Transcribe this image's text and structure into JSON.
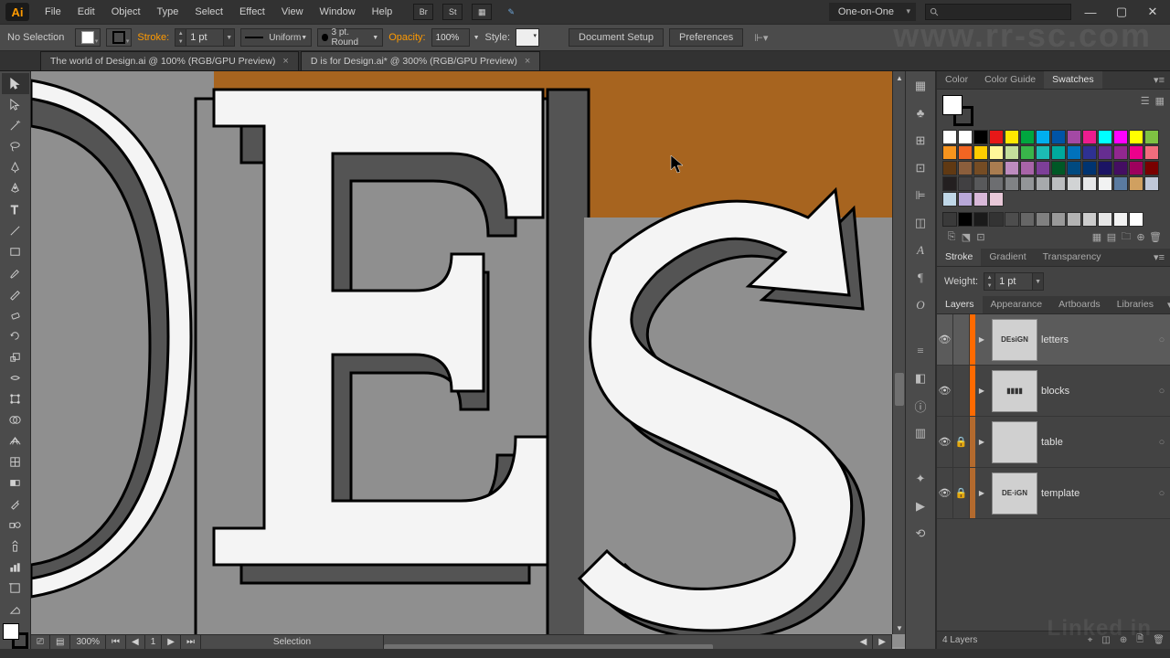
{
  "menu": {
    "items": [
      "File",
      "Edit",
      "Object",
      "Type",
      "Select",
      "Effect",
      "View",
      "Window",
      "Help"
    ]
  },
  "workspace": "One-on-One",
  "controlbar": {
    "selection": "No Selection",
    "stroke_label": "Stroke:",
    "stroke_weight": "1 pt",
    "stroke_profile": "Uniform",
    "brush": "3 pt. Round",
    "opacity_label": "Opacity:",
    "opacity": "100%",
    "style_label": "Style:",
    "btn_docsetup": "Document Setup",
    "btn_prefs": "Preferences"
  },
  "tabs": [
    {
      "title": "The world of Design.ai @ 100% (RGB/GPU Preview)",
      "active": false
    },
    {
      "title": "D is for Design.ai* @ 300% (RGB/GPU Preview)",
      "active": true
    }
  ],
  "statusbar": {
    "zoom": "300%",
    "artboard_nav": "1",
    "mode": "Selection"
  },
  "panels": {
    "color_tabs": [
      "Color",
      "Color Guide",
      "Swatches"
    ],
    "stroke_tabs": [
      "Stroke",
      "Gradient",
      "Transparency"
    ],
    "stroke_weight_label": "Weight:",
    "stroke_weight": "1 pt",
    "layer_tabs": [
      "Layers",
      "Appearance",
      "Artboards",
      "Libraries"
    ],
    "layers": [
      {
        "name": "letters",
        "color": "#ff6a00",
        "locked": false,
        "thumb_text": "DEsiGN"
      },
      {
        "name": "blocks",
        "color": "#ff6a00",
        "locked": false,
        "thumb_text": "▮▮▮▮"
      },
      {
        "name": "table",
        "color": "#b36a2e",
        "locked": true,
        "thumb_text": ""
      },
      {
        "name": "template",
        "color": "#b36a2e",
        "locked": true,
        "thumb_text": "DE·iGN"
      }
    ],
    "layer_count": "4 Layers"
  },
  "swatches": {
    "rows": [
      [
        "#ffffff",
        "#ffffff",
        "#000000",
        "#e71818",
        "#ffe800",
        "#00a63f",
        "#00aeef",
        "#0054a6",
        "#a349a4",
        "#ed1c8f",
        "#00ffff",
        "#ff00ff",
        "#ffff00",
        "#7ec242"
      ],
      [
        "#f7941d",
        "#f26522",
        "#ffcc00",
        "#fff799",
        "#c4df9b",
        "#39b54a",
        "#1cbbb4",
        "#00a99d",
        "#0072bc",
        "#2e3192",
        "#662d91",
        "#92278f",
        "#ec008c",
        "#f26d7d"
      ],
      [
        "#603913",
        "#8b5e3c",
        "#754c24",
        "#a97c50",
        "#bd8cbf",
        "#a864a8",
        "#7d3f98",
        "#005826",
        "#004a80",
        "#003471",
        "#1b1464",
        "#440e62",
        "#9e005d",
        "#790000"
      ],
      [
        "#231f20",
        "#414042",
        "#58595b",
        "#6d6e71",
        "#808285",
        "#939598",
        "#a7a9ac",
        "#bcbec0",
        "#d1d3d4",
        "#e6e7e8",
        "#f1f2f2",
        "#5a7aa0",
        "#d0a060",
        "#c0c8d8"
      ],
      [
        "#c0d8e8",
        "#b8a8d8",
        "#d8b8d8",
        "#e8c8d8",
        "",
        "",
        "",
        "",
        "",
        "",
        "",
        "",
        "",
        ""
      ]
    ],
    "gray_row": [
      "#000000",
      "#1a1a1a",
      "#333333",
      "#4d4d4d",
      "#666666",
      "#808080",
      "#999999",
      "#b3b3b3",
      "#cccccc",
      "#e6e6e6",
      "#f2f2f2",
      "#ffffff"
    ]
  }
}
